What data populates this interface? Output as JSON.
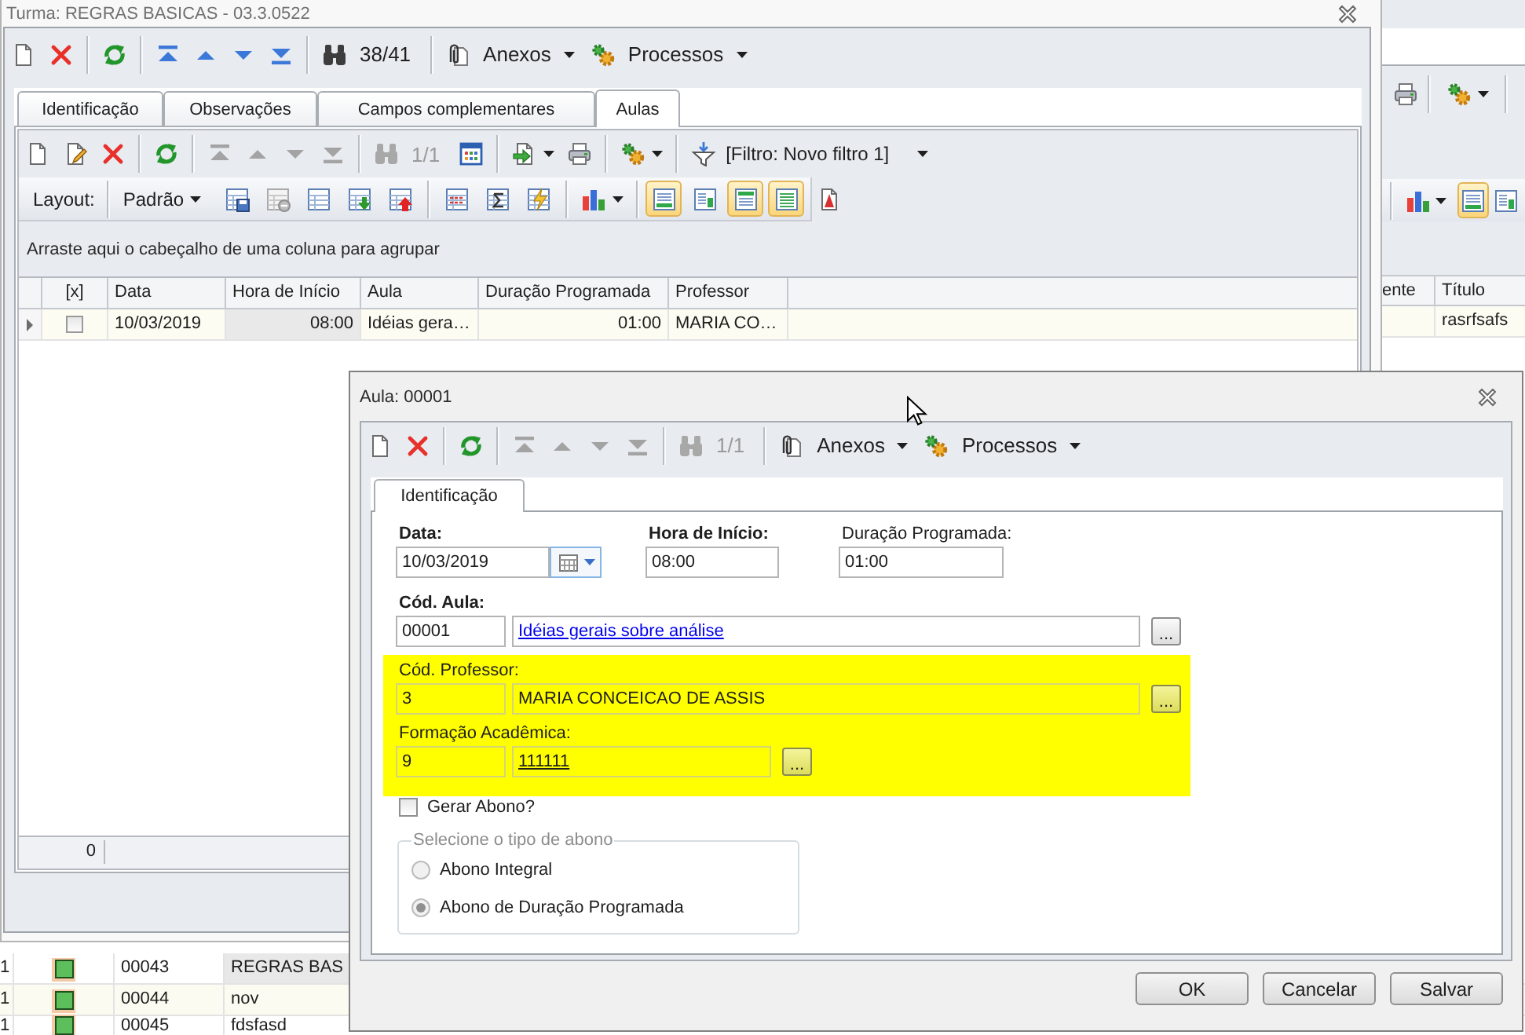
{
  "background_window": {
    "layout_toggles": [
      {
        "selected": true
      },
      {
        "selected": false
      }
    ],
    "grid": {
      "columns": [
        "ente",
        "Título"
      ],
      "rows": [
        {
          "title": "rasrfsafs"
        }
      ]
    },
    "list": {
      "rows": [
        {
          "cells": [
            {
              "text": "1",
              "selected": false
            },
            {
              "text": "00043",
              "selected": false
            },
            {
              "text": "REGRAS BAS",
              "selected": true
            }
          ]
        },
        {
          "cells": [
            {
              "text": "1",
              "selected": false
            },
            {
              "text": "00044",
              "selected": false
            },
            {
              "text": "nov",
              "selected": false
            }
          ]
        },
        {
          "cells": [
            {
              "text": "1",
              "selected": false
            },
            {
              "text": "00045",
              "selected": false
            },
            {
              "text": "fdsfasd",
              "selected": false
            }
          ]
        }
      ]
    }
  },
  "window": {
    "title": "Turma: REGRAS BASICAS - 03.3.0522",
    "toolbar": {
      "navigation_disabled": false,
      "counter": "38/41",
      "menus": [
        {
          "kind": "attachments",
          "label": "Anexos"
        },
        {
          "kind": "processes",
          "label": "Processos"
        }
      ]
    },
    "tabs": [
      {
        "label": "Identificação",
        "selected": false
      },
      {
        "label": "Observações",
        "selected": false
      },
      {
        "label": "Campos complementares",
        "selected": false
      },
      {
        "label": "Aulas",
        "selected": true
      }
    ],
    "lessons_panel": {
      "toolbar": {
        "navigation_disabled": true,
        "counter": "1/1",
        "filter": "[Filtro: Novo filtro 1]"
      },
      "layout_bar": {
        "label": "Layout:",
        "preset": "Padrão",
        "view_toggles": [
          {
            "selected": true
          },
          {
            "selected": false
          },
          {
            "selected": true
          },
          {
            "selected": true
          }
        ]
      },
      "group_panel": "Arraste aqui o cabeçalho de uma coluna para agrupar",
      "grid": {
        "columns": [
          "[x]",
          "Data",
          "Hora de Início",
          "Aula",
          "Duração Programada",
          "Professor"
        ],
        "rows": [
          {
            "selected": true,
            "cells": [
              {
                "kind": "checkbox",
                "checked": false,
                "selected": false
              },
              {
                "kind": "text",
                "text": "10/03/2019",
                "selected": false
              },
              {
                "kind": "text",
                "text": "08:00",
                "selected": true
              },
              {
                "kind": "text",
                "text": "Idéias gera…",
                "selected": false
              },
              {
                "kind": "text",
                "text": "01:00",
                "selected": false
              },
              {
                "kind": "text",
                "text": "MARIA CO…",
                "selected": false
              }
            ]
          }
        ]
      },
      "footer": {
        "count": "0"
      }
    }
  },
  "dialog": {
    "title": "Aula: 00001",
    "toolbar": {
      "navigation_disabled": true,
      "counter": "1/1",
      "menus": [
        {
          "kind": "attachments",
          "label": "Anexos"
        },
        {
          "kind": "processes",
          "label": "Processos"
        }
      ]
    },
    "tabs": [
      {
        "label": "Identificação",
        "selected": true
      }
    ],
    "fields": [
      {
        "kind": "date",
        "label": "Data:",
        "required": true,
        "value": "10/03/2019"
      },
      {
        "kind": "text",
        "label": "Hora de Início:",
        "required": true,
        "value": "08:00"
      },
      {
        "kind": "text",
        "label": "Duração Programada:",
        "required": false,
        "value": "01:00"
      }
    ],
    "lookups": [
      {
        "kind": "link",
        "label": "Cód. Aula:",
        "required": true,
        "code": "00001",
        "description": "Idéias gerais sobre análise",
        "button": "..."
      }
    ],
    "highlight_group": {
      "lookups": [
        {
          "kind": "plain",
          "label": "Cód. Professor:",
          "required": false,
          "code": "3",
          "description": "MARIA CONCEICAO DE ASSIS",
          "button": "..."
        },
        {
          "kind": "underlined",
          "label": "Formação Acadêmica:",
          "required": false,
          "code": "9",
          "description": "111111",
          "button": "..."
        }
      ]
    },
    "checkbox": {
      "label": "Gerar Abono?",
      "checked": false
    },
    "abono_group": {
      "legend": "Selecione o tipo de abono",
      "disabled": true,
      "options": [
        {
          "label": "Abono Integral",
          "selected": false
        },
        {
          "label": "Abono de Duração Programada",
          "selected": true
        }
      ]
    },
    "buttons": [
      {
        "label": "OK"
      },
      {
        "label": "Cancelar"
      },
      {
        "label": "Salvar"
      }
    ]
  }
}
